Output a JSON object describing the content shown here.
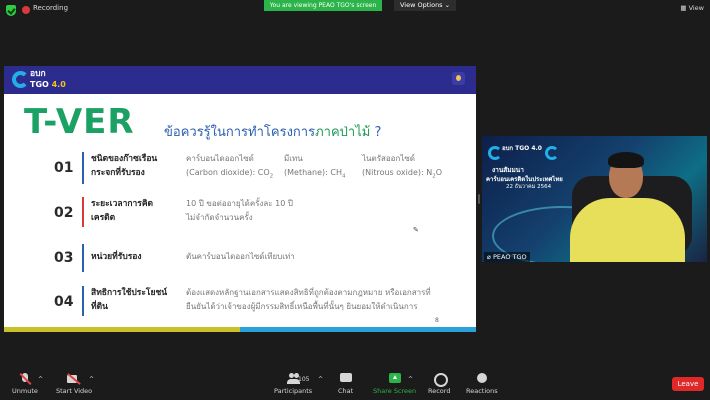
{
  "topbar": {
    "recording_label": "Recording",
    "banner_text": "You are viewing PEAO TGO's screen",
    "view_options_label": "View Options",
    "view_options_caret": "⌄",
    "view_button_label": "View"
  },
  "slide": {
    "logo_text_top": "อบก",
    "logo_text_bottom": "TGO",
    "logo_version": " 4.0",
    "title": "T-VER",
    "subtitle_main": "ข้อควรรู้ในการทำโครงการ",
    "subtitle_highlight": "ภาคป่าไม้",
    "subtitle_end": " ?",
    "page_number": "8",
    "pen_icon_glyph": "✎",
    "rows": [
      {
        "num": "01",
        "title": "ชนิดของก๊าซเรือนกระจกที่รับรอง",
        "bar_color": "#2b5fb0",
        "cells": [
          {
            "line1": "คาร์บอนไดออกไซด์",
            "line2": "(Carbon dioxide): CO",
            "sub": "2"
          },
          {
            "line1": "มีเทน",
            "line2": "(Methane): CH",
            "sub": "4"
          },
          {
            "line1": "ไนตรัสออกไซด์",
            "line2": "(Nitrous oxide): N",
            "sub": "2",
            "suffix": "O"
          }
        ]
      },
      {
        "num": "02",
        "title": "ระยะเวลาการคิดเครดิต",
        "bar_color": "#d63a3a",
        "text_line1": "10 ปี ขอต่ออายุได้ครั้งละ 10 ปี",
        "text_line2": "ไม่จำกัดจำนวนครั้ง"
      },
      {
        "num": "03",
        "title": "หน่วยที่รับรอง",
        "bar_color": "#2b5fb0",
        "text_line1": "ตันคาร์บอนไดออกไซด์เทียบเท่า"
      },
      {
        "num": "04",
        "title": "สิทธิการใช้ประโยชน์ที่ดิน",
        "bar_color": "#2b5fb0",
        "text_line1": "ต้องแสดงหลักฐานเอกสารแสดงสิทธิที่ถูกต้องตามกฎหมาย หรือเอกสารที่",
        "text_line2": "ยืนยันได้ว่าเจ้าของผู้มีกรรมสิทธิ์เหนือพื้นที่นั้นๆ ยินยอมให้ดำเนินการ"
      }
    ]
  },
  "video": {
    "logo_text": "อบก TGO 4.0",
    "line1": "งานสัมมนา",
    "line2": "คาร์บอนเครดิตในประเทศไทย",
    "line3": "22 ธันวาคม 2564",
    "participant_name": "PEAO TGO"
  },
  "toolbar": {
    "unmute": "Unmute",
    "start_video": "Start Video",
    "participants": "Participants",
    "participants_count": "105",
    "chat": "Chat",
    "share_screen": "Share Screen",
    "record": "Record",
    "reactions": "Reactions",
    "leave": "Leave",
    "caret": "^"
  },
  "colors": {
    "accent_green": "#2bb44a",
    "leave_red": "#e02828",
    "slide_header_blue": "#2b2c8e",
    "tver_green": "#1aa163"
  }
}
